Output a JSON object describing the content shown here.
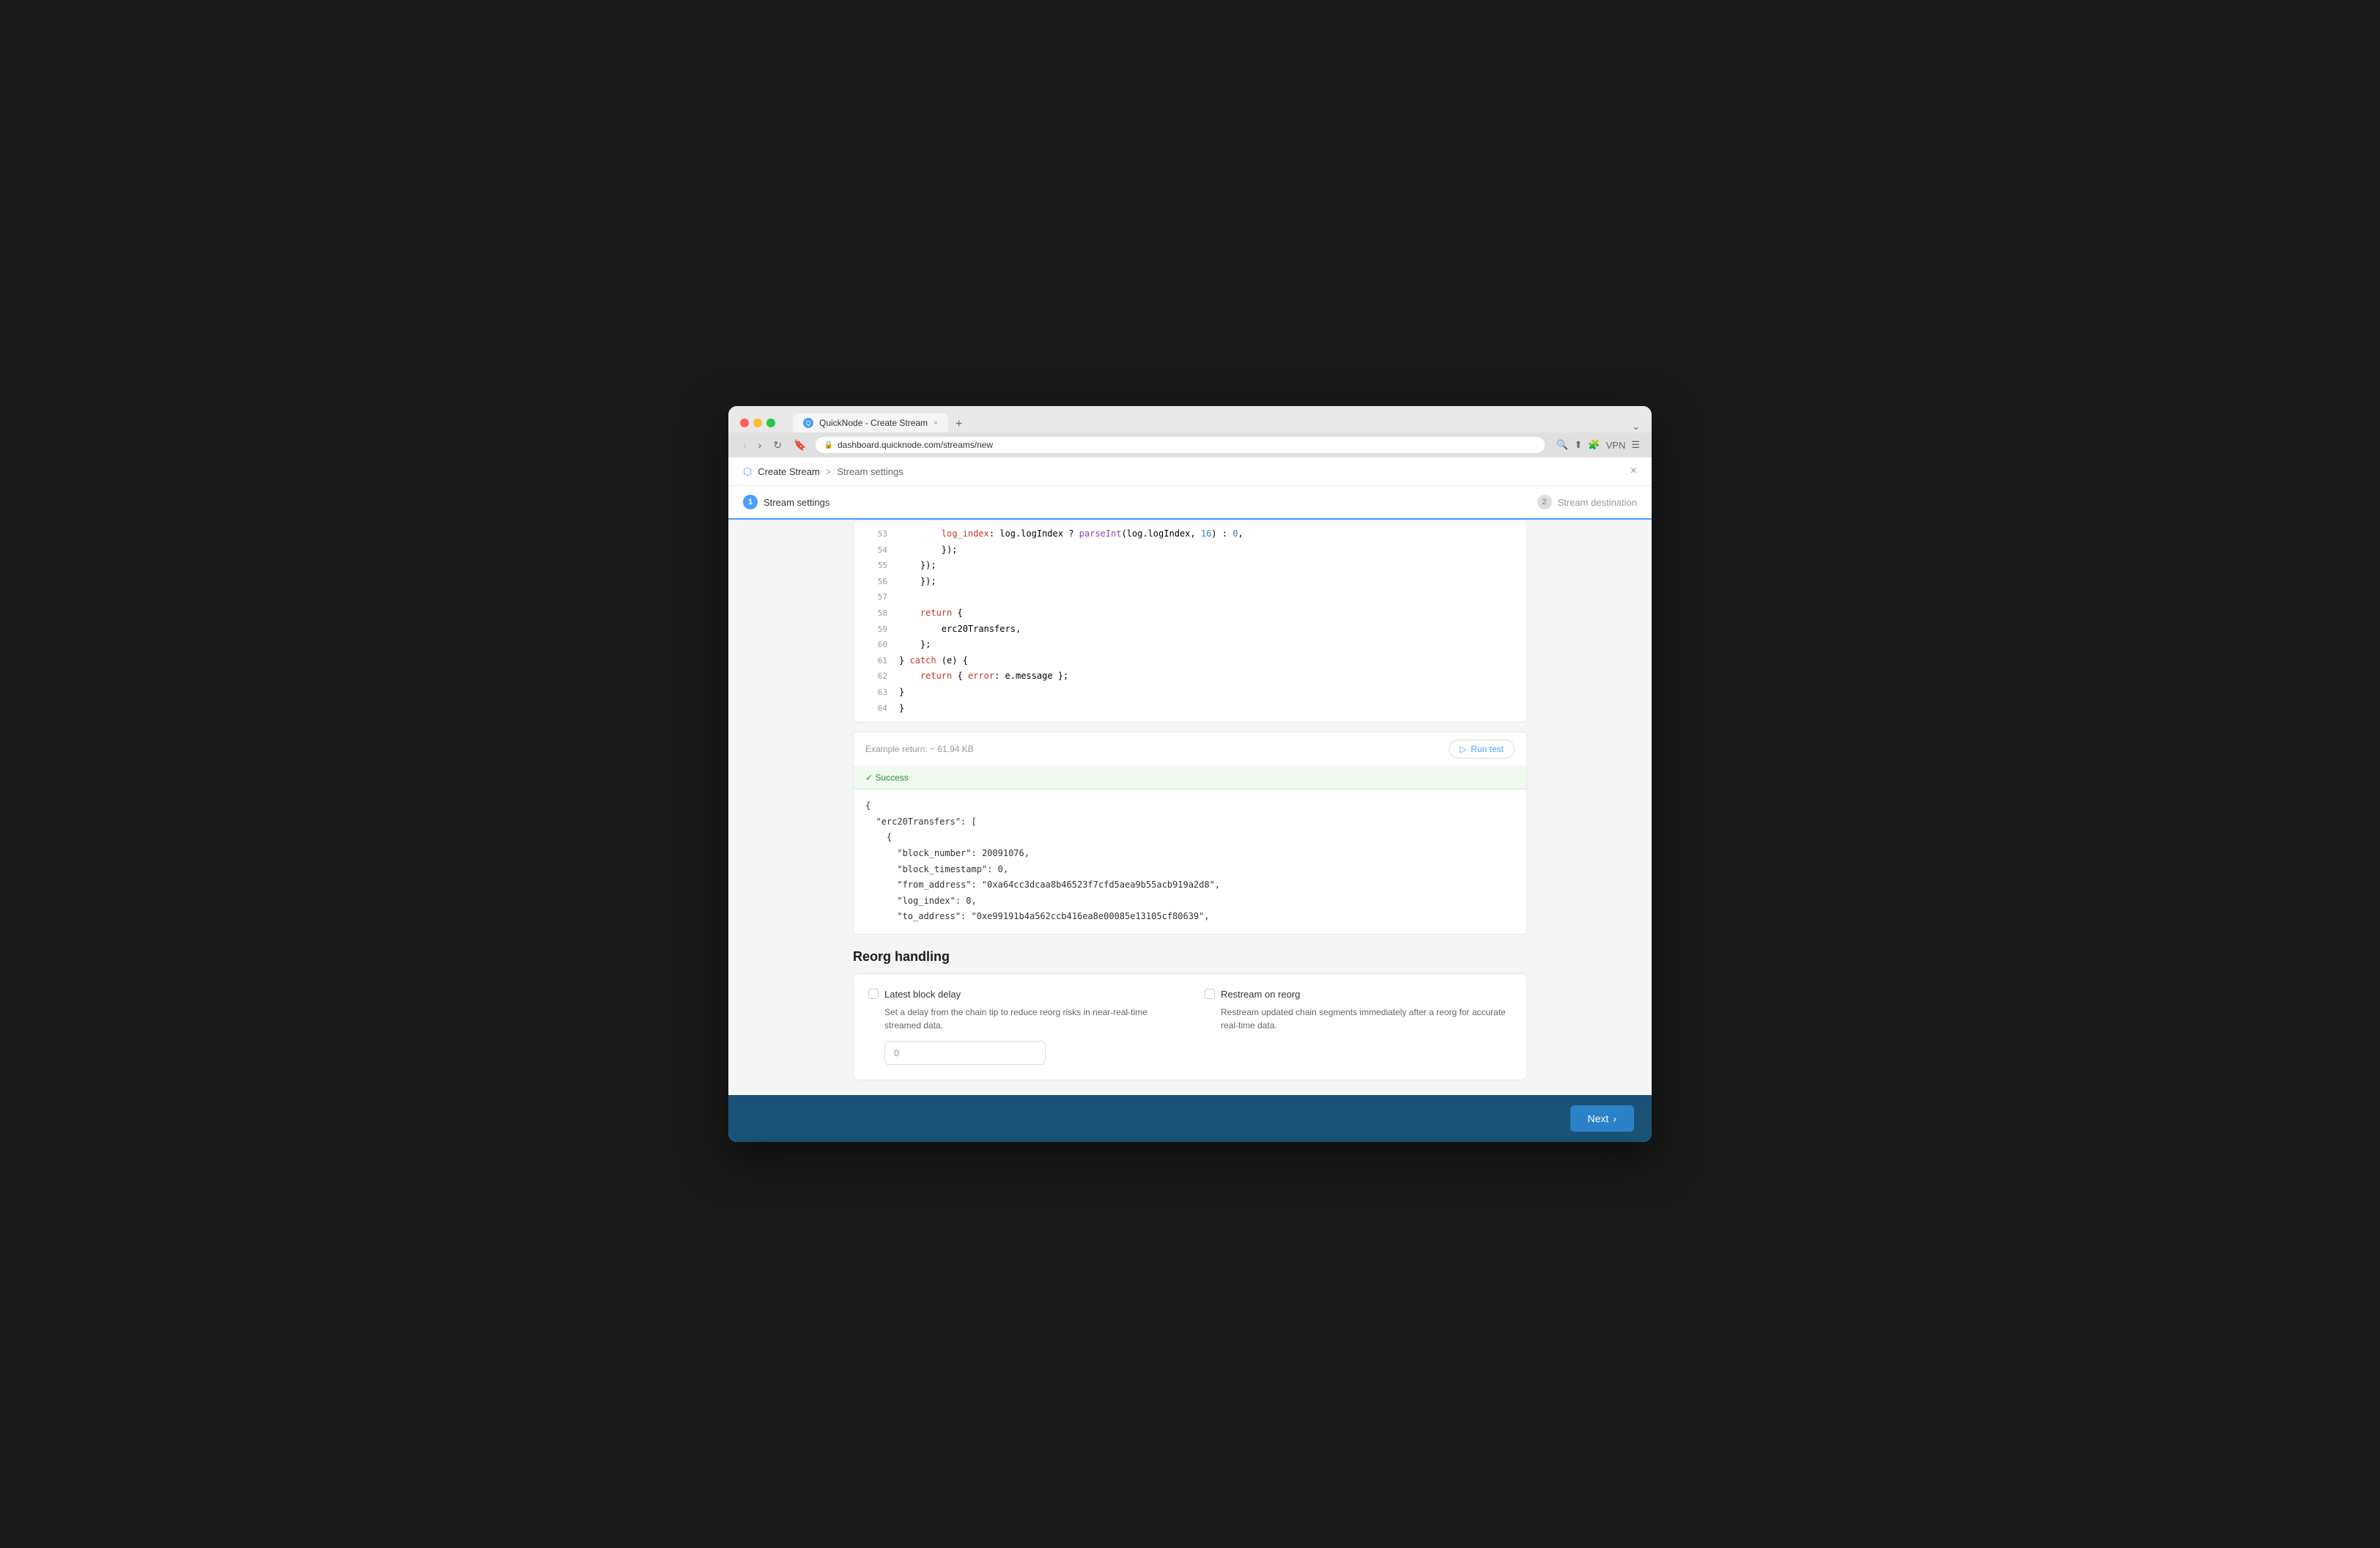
{
  "browser": {
    "tab_title": "QuickNode - Create Stream",
    "url": "dashboard.quicknode.com/streams/new"
  },
  "breadcrumb": {
    "home": "Create Stream",
    "separator": ">",
    "current": "Stream settings"
  },
  "close_label": "×",
  "steps": [
    {
      "number": "1",
      "label": "Stream settings",
      "active": true
    },
    {
      "number": "2",
      "label": "Stream destination",
      "active": false
    }
  ],
  "code": {
    "lines": [
      {
        "num": "53",
        "content": "        log_index: log.logIndex ? parseInt(log.logIndex, 16) : 0,",
        "type": "mixed"
      },
      {
        "num": "54",
        "content": "        });",
        "type": "plain"
      },
      {
        "num": "55",
        "content": "    });",
        "type": "plain"
      },
      {
        "num": "56",
        "content": "    });",
        "type": "plain"
      },
      {
        "num": "57",
        "content": "",
        "type": "plain"
      },
      {
        "num": "58",
        "content": "    return {",
        "type": "keyword"
      },
      {
        "num": "59",
        "content": "        erc20Transfers,",
        "type": "plain"
      },
      {
        "num": "60",
        "content": "    };",
        "type": "plain"
      },
      {
        "num": "61",
        "content": "} catch (e) {",
        "type": "keyword"
      },
      {
        "num": "62",
        "content": "    return { error: e.message };",
        "type": "mixed"
      },
      {
        "num": "63",
        "content": "}",
        "type": "plain"
      },
      {
        "num": "64",
        "content": "}",
        "type": "plain"
      }
    ]
  },
  "example_return": {
    "label": "Example return: ~ 61.94 KB",
    "run_test": "Run test"
  },
  "success": {
    "label": "✓ Success"
  },
  "json_output": {
    "lines": [
      "{",
      "  \"erc20Transfers\": [",
      "    {",
      "      \"block_number\": 20091076,",
      "      \"block_timestamp\": 0,",
      "      \"from_address\": \"0xa64cc3dcaa8b46523f7cfd5aea9b55acb919a2d8\",",
      "      \"log_index\": 0,",
      "      \"to_address\": \"0xe99191b4a562ccb416ea8e00085e13105cf80639\","
    ]
  },
  "reorg": {
    "title": "Reorg handling",
    "latest_block_delay": {
      "label": "Latest block delay",
      "checked": false,
      "description": "Set a delay from the chain tip to reduce reorg risks in near-real-time streamed data.",
      "input_value": "0",
      "input_placeholder": "0"
    },
    "restream_on_reorg": {
      "label": "Restream on reorg",
      "checked": false,
      "description": "Restream updated chain segments immediately after a reorg for accurate real-time data."
    }
  },
  "footer": {
    "next_label": "Next",
    "next_arrow": "›"
  }
}
